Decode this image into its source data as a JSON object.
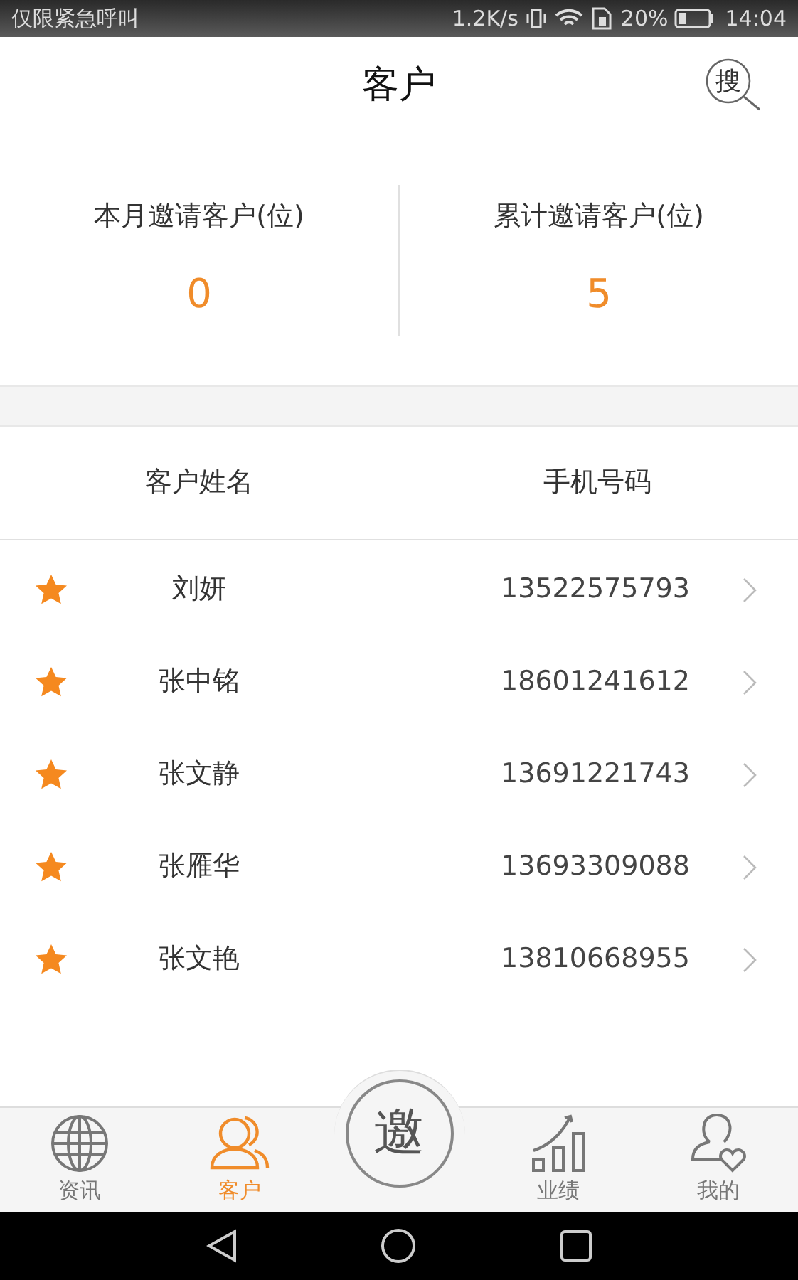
{
  "status_bar": {
    "carrier": "仅限紧急呼叫",
    "speed": "1.2K/s",
    "battery": "20%",
    "time": "14:04"
  },
  "header": {
    "title": "客户",
    "search": "搜"
  },
  "stats": [
    {
      "label": "本月邀请客户(位)",
      "value": "0"
    },
    {
      "label": "累计邀请客户(位)",
      "value": "5"
    }
  ],
  "table": {
    "columns": [
      "客户姓名",
      "手机号码"
    ],
    "rows": [
      {
        "name": "刘妍",
        "phone": "13522575793",
        "starred": true
      },
      {
        "name": "张中铭",
        "phone": "18601241612",
        "starred": true
      },
      {
        "name": "张文静",
        "phone": "13691221743",
        "starred": true
      },
      {
        "name": "张雁华",
        "phone": "13693309088",
        "starred": true
      },
      {
        "name": "张文艳",
        "phone": "13810668955",
        "starred": true
      }
    ]
  },
  "bottom_nav": {
    "items": [
      {
        "kind": "globe",
        "label": "资讯",
        "selected": false
      },
      {
        "kind": "people",
        "label": "客户",
        "selected": true
      },
      {
        "kind": "invite",
        "label": "邀",
        "selected": false
      },
      {
        "kind": "chart",
        "label": "业绩",
        "selected": false
      },
      {
        "kind": "person",
        "label": "我的",
        "selected": false
      }
    ]
  }
}
